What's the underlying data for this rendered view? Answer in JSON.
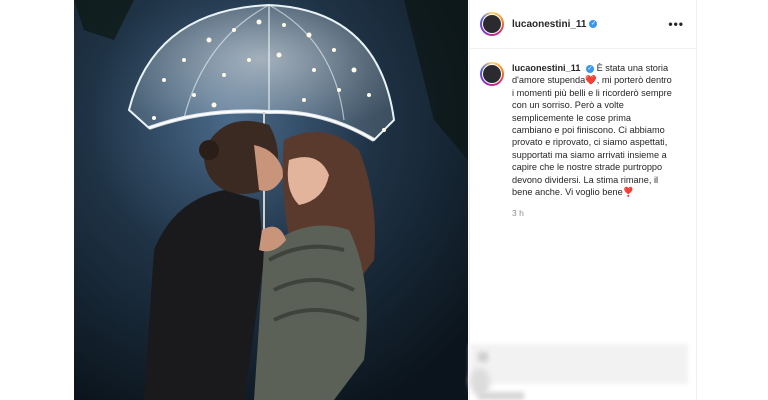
{
  "post": {
    "author": "lucaonestini_11",
    "verified_icon": "verified-badge-icon",
    "more_icon": "more-options-icon",
    "more_label": "•••"
  },
  "caption": {
    "author": "lucaonestini_11",
    "text_part1": "È stata una storia d'amore stupenda",
    "heart1": "❤️",
    "text_part2": ", mi porterò dentro i momenti più belli e li ricorderò sempre con un sorriso. Però a volte semplicemente le cose prima cambiano e poi finiscono. Ci abbiamo provato e riprovato, ci siamo aspettati, supportati ma siamo arrivati insieme a capire che le nostre strade purtroppo devono dividersi. La stima rimane, il bene anche. Vi voglio bene",
    "heart2": "❣️",
    "time": "3 h"
  },
  "colors": {
    "accent": "#3897f0",
    "heart": "#d8232a",
    "muted": "#8e8e8e"
  }
}
